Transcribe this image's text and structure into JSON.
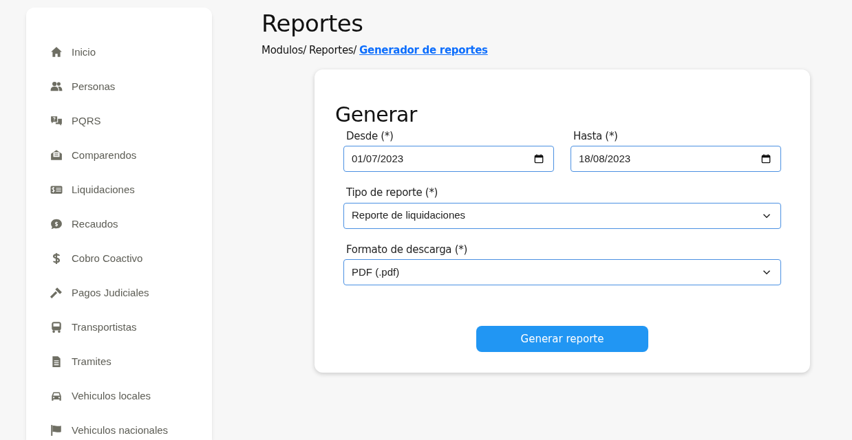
{
  "sidebar": {
    "items": [
      {
        "label": "Inicio"
      },
      {
        "label": "Personas"
      },
      {
        "label": "PQRS"
      },
      {
        "label": "Comparendos"
      },
      {
        "label": "Liquidaciones"
      },
      {
        "label": "Recaudos"
      },
      {
        "label": "Cobro Coactivo"
      },
      {
        "label": "Pagos Judiciales"
      },
      {
        "label": "Transportistas"
      },
      {
        "label": "Tramites"
      },
      {
        "label": "Vehiculos locales"
      },
      {
        "label": "Vehiculos nacionales"
      }
    ]
  },
  "page": {
    "title": "Reportes",
    "breadcrumb": [
      "Modulos/",
      "Reportes/"
    ],
    "breadcrumb_current": "Generador de reportes"
  },
  "form": {
    "title": "Generar",
    "fields": [
      {
        "kind": "date",
        "label": "Desde (*)",
        "value": "01/07/2023"
      },
      {
        "kind": "date",
        "label": "Hasta (*)",
        "value": "18/08/2023"
      },
      {
        "kind": "select",
        "label": "Tipo de reporte (*)",
        "value": "Reporte de liquidaciones"
      },
      {
        "kind": "select",
        "label": "Formato de descarga (*)",
        "value": "PDF (.pdf)"
      }
    ],
    "button": "Generar reporte"
  }
}
